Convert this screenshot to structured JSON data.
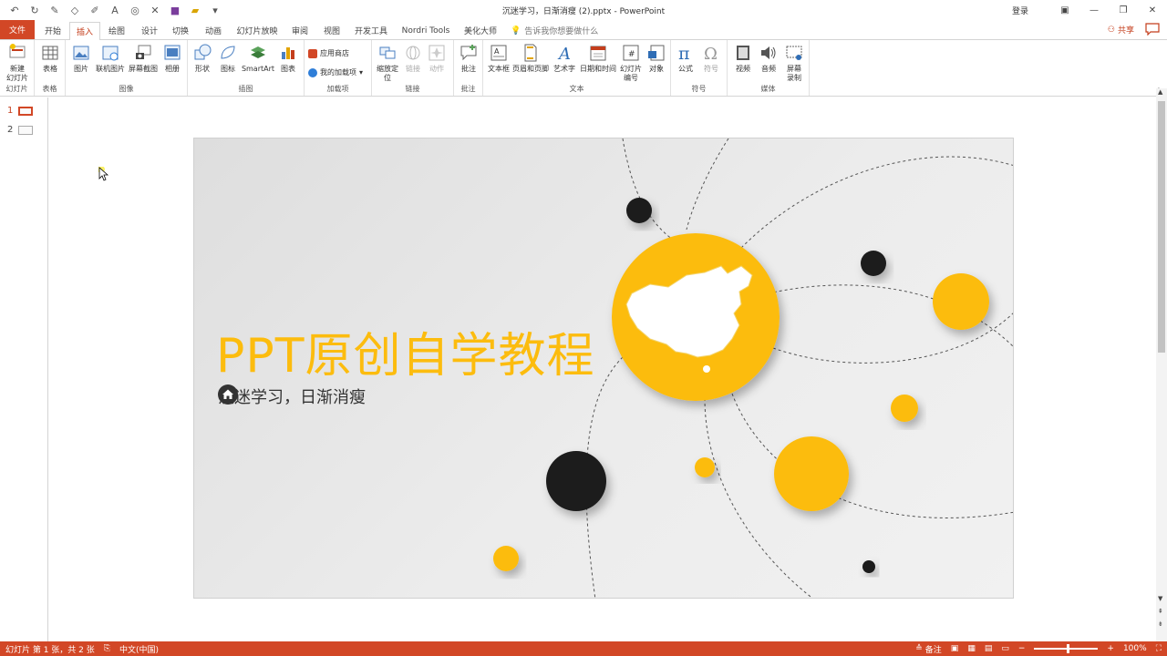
{
  "window": {
    "title": "沉迷学习，日渐消瘦 (2).pptx - PowerPoint",
    "login": "登录",
    "share": "共享",
    "tell_me": "告诉我你想要做什么"
  },
  "tabs": [
    "文件",
    "开始",
    "插入",
    "绘图",
    "设计",
    "切换",
    "动画",
    "幻灯片放映",
    "审阅",
    "视图",
    "开发工具",
    "Nordri Tools",
    "美化大师"
  ],
  "active_tab": "插入",
  "ribbon": {
    "groups": {
      "slides": "幻灯片",
      "tables": "表格",
      "images": "图像",
      "illustrations": "插图",
      "addins": "加载项",
      "links": "链接",
      "comments": "批注",
      "text": "文本",
      "symbols": "符号",
      "media": "媒体"
    },
    "buttons": {
      "new_slide": "新建\n幻灯片",
      "table": "表格",
      "picture": "图片",
      "online_picture": "联机图片",
      "screenshot": "屏幕截图",
      "album": "相册",
      "shapes": "形状",
      "icons": "图标",
      "smartart": "SmartArt",
      "chart": "图表",
      "store": "应用商店",
      "my_addins": "我的加载项",
      "zoom": "缩放定\n位",
      "link": "链接",
      "action": "动作",
      "comment": "批注",
      "textbox": "文本框",
      "header_footer": "页眉和页脚",
      "wordart": "艺术字",
      "datetime": "日期和时间",
      "slide_number": "幻灯片\n编号",
      "object": "对象",
      "equation": "公式",
      "symbol": "符号",
      "video": "视频",
      "audio": "音频",
      "screen_recording": "屏幕\n录制"
    }
  },
  "thumbnails": [
    "1",
    "2"
  ],
  "slide": {
    "title": "PPT原创自学教程",
    "subtitle": "沉迷学习，日渐消瘦",
    "colors": {
      "accent": "#fcbc0e",
      "dark": "#1a1a1a"
    }
  },
  "status": {
    "slide_info": "幻灯片 第 1 张，共 2 张",
    "language": "中文(中国)",
    "notes": "备注",
    "zoom": "100%"
  }
}
